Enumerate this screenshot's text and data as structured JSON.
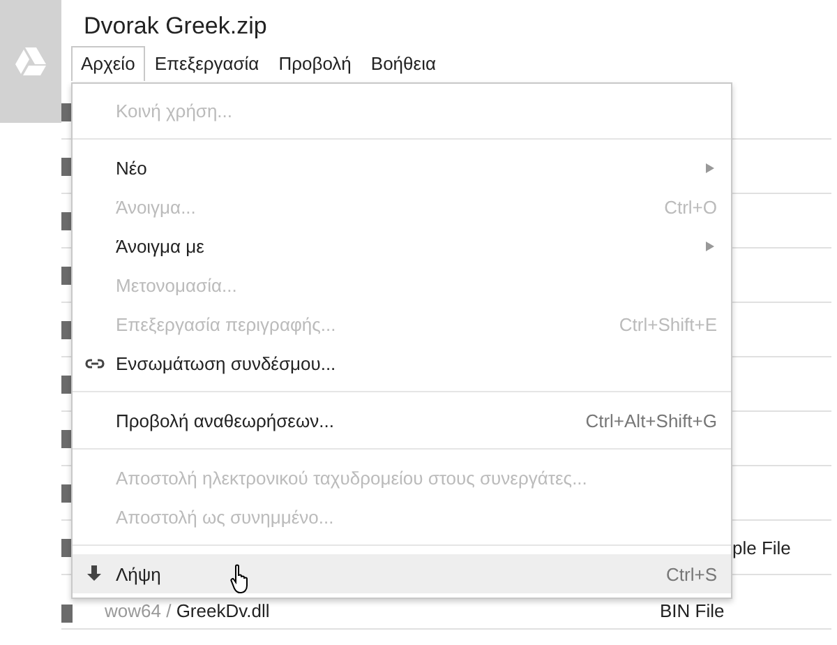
{
  "window": {
    "title": "Dvorak Greek.zip"
  },
  "menubar": [
    {
      "label": "Αρχείο",
      "selected": true
    },
    {
      "label": "Επεξεργασία",
      "selected": false
    },
    {
      "label": "Προβολή",
      "selected": false
    },
    {
      "label": "Βοήθεια",
      "selected": false
    }
  ],
  "menu": [
    {
      "kind": "item",
      "label": "Κοινή χρήση...",
      "disabled": true,
      "selected": false
    },
    {
      "kind": "separator"
    },
    {
      "kind": "item",
      "label": "Νέο",
      "submenu": true,
      "disabled": false,
      "selected": false
    },
    {
      "kind": "item",
      "label": "Άνοιγμα...",
      "shortcut": "Ctrl+O",
      "disabled": true,
      "selected": false
    },
    {
      "kind": "item",
      "label": "Άνοιγμα με",
      "submenu": true,
      "disabled": false,
      "selected": false
    },
    {
      "kind": "item",
      "label": "Μετονομασία...",
      "disabled": true,
      "selected": false
    },
    {
      "kind": "item",
      "label": "Επεξεργασία περιγραφής...",
      "shortcut": "Ctrl+Shift+E",
      "disabled": true,
      "selected": false
    },
    {
      "kind": "link",
      "label": "Ενσωμάτωση συνδέσμου...",
      "disabled": false,
      "selected": false
    },
    {
      "kind": "separator"
    },
    {
      "kind": "item",
      "label": "Προβολή αναθεωρήσεων...",
      "shortcut": "Ctrl+Alt+Shift+G",
      "disabled": false,
      "selected": false
    },
    {
      "kind": "separator"
    },
    {
      "kind": "item",
      "label": "Αποστολή ηλεκτρονικού ταχυδρομείου στους συνεργάτες...",
      "disabled": true,
      "selected": false
    },
    {
      "kind": "item",
      "label": "Αποστολή ως συνημμένο...",
      "disabled": true,
      "selected": false
    },
    {
      "kind": "separator"
    },
    {
      "kind": "download",
      "label": "Λήψη",
      "shortcut": "Ctrl+S",
      "disabled": false,
      "selected": true
    }
  ],
  "files": [
    {
      "type": "ple File"
    },
    {
      "path": "wow64 / ",
      "name": "GreekDv.dll",
      "type": "BIN File"
    }
  ]
}
